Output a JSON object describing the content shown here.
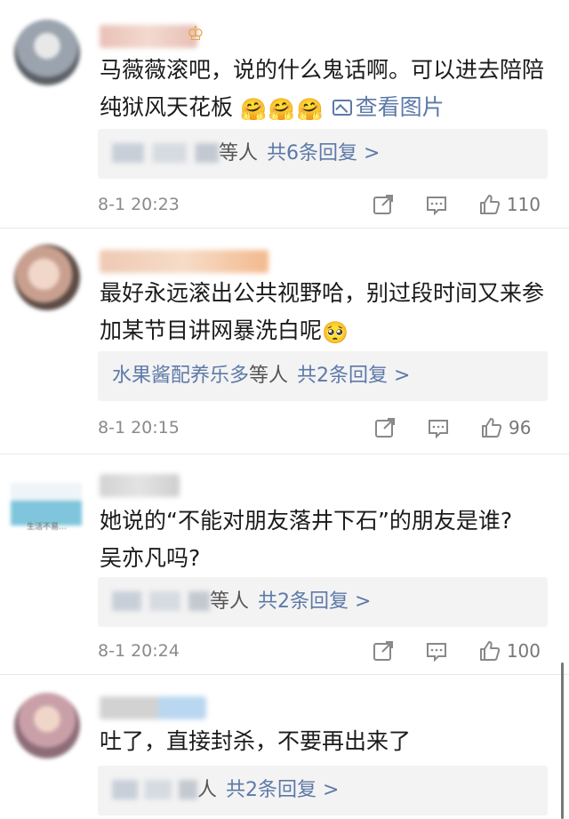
{
  "comments": [
    {
      "username": "••••鬼 ↯",
      "text_line1": "马薇薇滚吧，说的什么鬼话啊。可以进去陪陪",
      "text_line2": "纯狱风天花板",
      "emojis": [
        "🤗",
        "🤗",
        "🤗"
      ],
      "image_link": "查看图片",
      "reply_label": "等人",
      "reply_count": "共6条回复 >",
      "time": "8-1 20:23",
      "likes": "110",
      "avatar_color": "#9aa3ae"
    },
    {
      "username": "••••••••",
      "text_line1": "最好永远滚出公共视野哈，别过段时间又来参",
      "text_line2": "加某节目讲网暴洗白呢",
      "emojis": [
        "🥺"
      ],
      "reply_names": "水果酱配养乐多",
      "reply_label": "等人",
      "reply_count": "共2条回复 >",
      "time": "8-1 20:15",
      "likes": "96",
      "avatar_color": "#d9b8a8"
    },
    {
      "username": "•••••",
      "text_line1": "她说的“不能对朋友落井下石”的朋友是谁?",
      "text_line2": "吴亦凡吗?",
      "avatar_caption": "生活不易…",
      "reply_label": "等人",
      "reply_count": "共2条回复 >",
      "time": "8-1 20:24",
      "likes": "100",
      "avatar_color": "#7fbfd6"
    },
    {
      "username": "•••",
      "text_line1": "吐了，直接封杀，不要再出来了",
      "reply_label": "人",
      "reply_count": "共2条回复 >",
      "avatar_color": "#c7a3b3"
    }
  ],
  "icons": {
    "share": "share-icon",
    "comment": "comment-icon",
    "like": "thumbs-up-icon",
    "image": "image-icon"
  },
  "colors": {
    "link_blue": "#5d79a8",
    "reply_bg": "#f3f3f3",
    "meta_gray": "#8a8a8a"
  }
}
